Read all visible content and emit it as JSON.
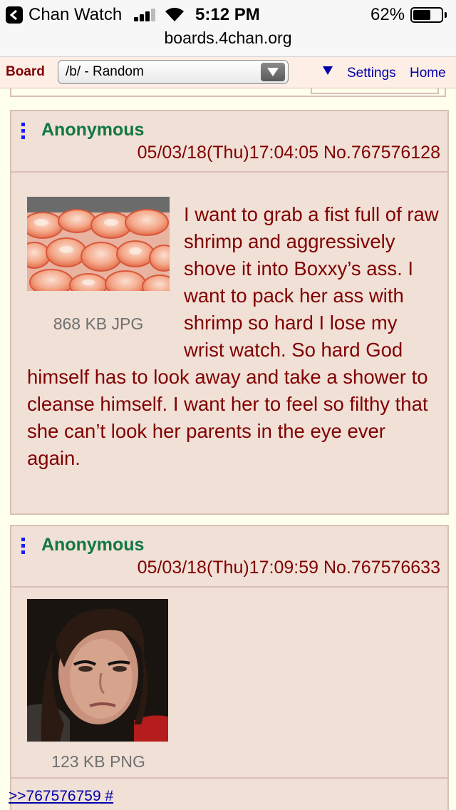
{
  "status_bar": {
    "back_app": "Chan Watch",
    "time": "5:12 PM",
    "battery_pct": "62%",
    "battery_level": 0.62,
    "url": "boards.4chan.org"
  },
  "toolbar": {
    "board_label": "Board",
    "board_select_value": "/b/ - Random",
    "settings_label": "Settings",
    "home_label": "Home"
  },
  "posts": [
    {
      "name": "Anonymous",
      "date": "05/03/18(Thu)17:04:05",
      "number": "No.767576128",
      "file_info": "868 KB JPG",
      "thumbnail": "shrimp-photo",
      "text": "I want to grab a fist full of raw shrimp and aggressively shove it into Boxxy’s ass. I want to pack her ass with shrimp so hard I lose my wrist watch. So hard God himself has to look away and take a shower to cleanse himself. I want her to feel so filthy that she can’t look her parents in the eye ever again."
    },
    {
      "name": "Anonymous",
      "date": "05/03/18(Thu)17:09:59",
      "number": "No.767576633",
      "file_info": "123 KB PNG",
      "thumbnail": "girl-portrait-photo",
      "reply_link": ">>767576759 #"
    }
  ],
  "colors": {
    "background": "#ffffee",
    "post_bg": "#f0e0d6",
    "post_border": "#d9bfb7",
    "name": "#117743",
    "text": "#800000",
    "link": "#0000aa"
  }
}
